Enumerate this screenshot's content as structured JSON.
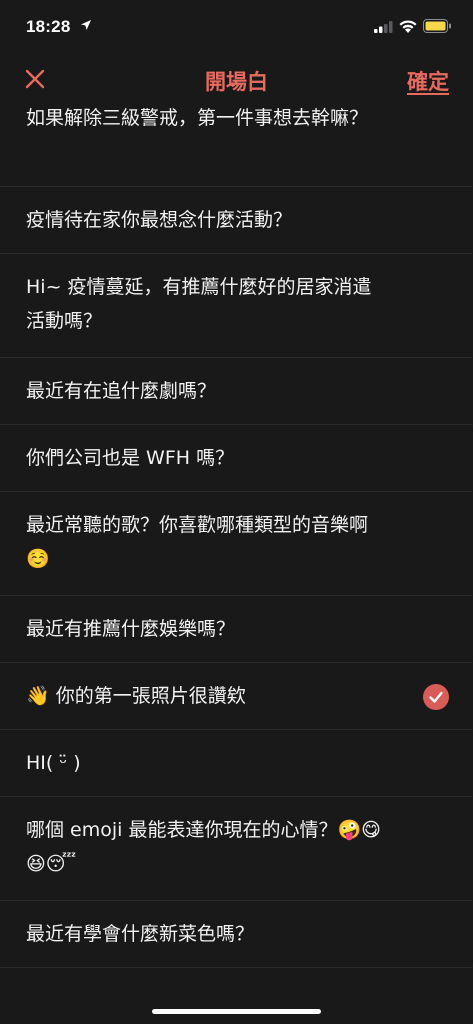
{
  "status": {
    "time": "18:28"
  },
  "nav": {
    "title": "開場白",
    "confirm_label": "確定"
  },
  "openers": [
    {
      "text": "如果解除三級警戒，第一件事想去幹嘛？",
      "selected": false
    },
    {
      "text": "疫情待在家你最想念什麼活動？",
      "selected": false
    },
    {
      "text": "Hi~ 疫情蔓延，有推薦什麼好的居家消遣活動嗎？",
      "selected": false
    },
    {
      "text": "最近有在追什麼劇嗎？",
      "selected": false
    },
    {
      "text": "你們公司也是 WFH 嗎？",
      "selected": false
    },
    {
      "text": "最近常聽的歌？你喜歡哪種類型的音樂啊☺️",
      "selected": false
    },
    {
      "text": "最近有推薦什麼娛樂嗎？",
      "selected": false
    },
    {
      "text": "👋 你的第一張照片很讚欸",
      "selected": true
    },
    {
      "text": "HI( ᵕ̈ )",
      "selected": false
    },
    {
      "text": "哪個 emoji 最能表達你現在的心情？🤪😋😆😴",
      "selected": false
    },
    {
      "text": "最近有學會什麼新菜色嗎？",
      "selected": false
    }
  ],
  "colors": {
    "accent": "#e66a5e",
    "check": "#d95c56",
    "background": "#19191a",
    "divider": "#2c2c2e"
  }
}
